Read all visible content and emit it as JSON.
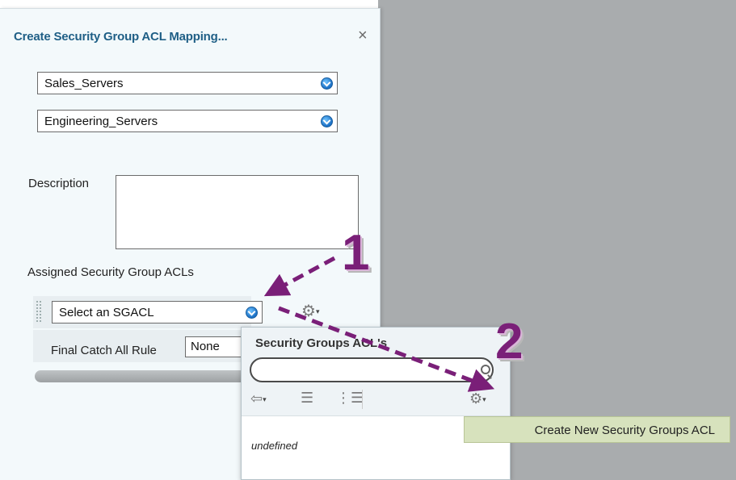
{
  "panel": {
    "title": "Create Security Group ACL Mapping...",
    "close_symbol": "×"
  },
  "source_select": {
    "value": "Sales_Servers"
  },
  "destination_select": {
    "value": "Engineering_Servers"
  },
  "description": {
    "label": "Description",
    "value": ""
  },
  "assigned": {
    "heading": "Assigned Security Group ACLs",
    "sgacl_select": {
      "value": "Select an SGACL"
    },
    "gear_caret": "▾",
    "final_rule_label": "Final Catch All Rule",
    "final_rule_value": "None"
  },
  "popup": {
    "title": "Security Groups ACL's",
    "search_value": "",
    "back_caret": "▾",
    "gear_caret": "▾",
    "empty_text": "undefined"
  },
  "menu": {
    "create_label": "Create New Security Groups ACL"
  },
  "callouts": {
    "one": "1",
    "two": "2"
  },
  "icons": {
    "close": "close-icon",
    "dropdown": "chevron-down-circle-icon",
    "gear": "gear-icon",
    "search": "search-icon",
    "back": "back-arrow-icon",
    "list": "list-view-icon",
    "tree": "tree-view-icon"
  },
  "colors": {
    "title": "#1f5f86",
    "callout": "#7a1f78",
    "menu_highlight": "#d7e2bd",
    "backdrop": "#a9acae"
  }
}
